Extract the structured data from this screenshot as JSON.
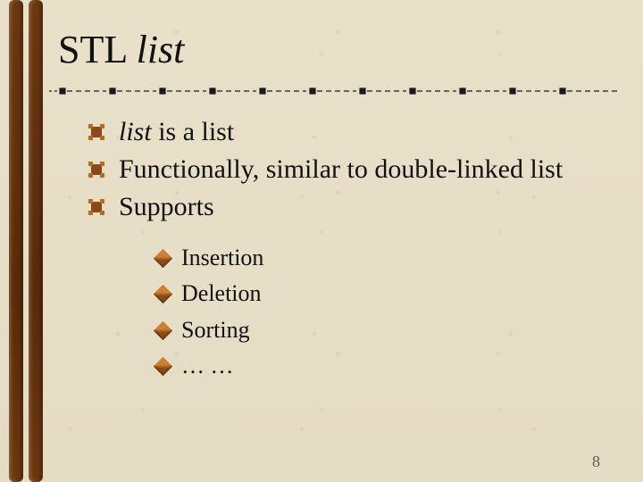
{
  "title": {
    "prefix": "STL ",
    "italic": "list"
  },
  "divider": {
    "segments": 10
  },
  "bullets_level1": [
    {
      "italic": "list",
      "rest": " is a list"
    },
    {
      "rest": "Functionally, similar to double-linked list"
    },
    {
      "rest": "Supports"
    }
  ],
  "bullets_level2": [
    "Insertion",
    "Deletion",
    "Sorting",
    "… …"
  ],
  "page_number": "8"
}
